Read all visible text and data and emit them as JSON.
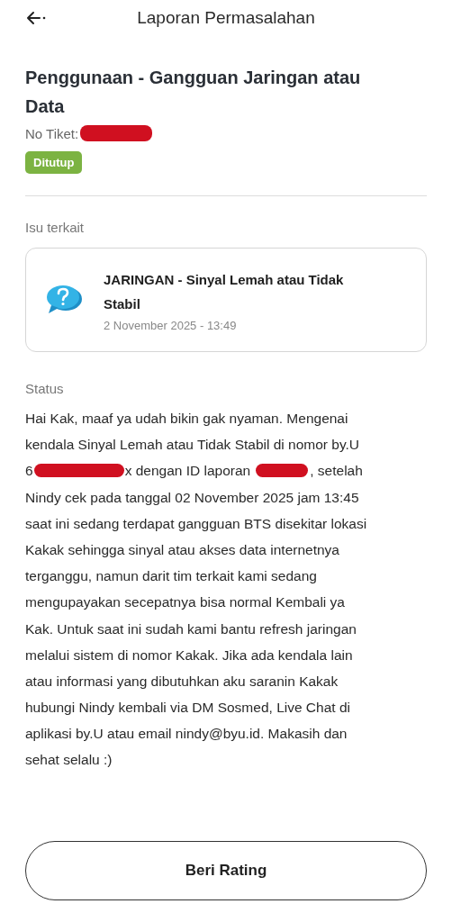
{
  "header": {
    "title": "Laporan Permasalahan"
  },
  "ticket": {
    "title": "Penggunaan - Gangguan Jaringan atau Data",
    "number_label": "No Tiket:",
    "number_redacted": true,
    "status": "Ditutup"
  },
  "related": {
    "label": "Isu terkait",
    "title": "JARINGAN - Sinyal Lemah atau Tidak Stabil",
    "time": "2 November 2025 - 13:49"
  },
  "status": {
    "label": "Status",
    "message_lines": [
      [
        {
          "kind": "text",
          "text": "Hai Kak, maaf ya udah bikin gak nyaman. Mengenai"
        }
      ],
      [
        {
          "kind": "text",
          "text": "kendala Sinyal Lemah atau Tidak Stabil di nomor by.U"
        }
      ],
      [
        {
          "kind": "text",
          "text": "6"
        },
        {
          "kind": "redaction"
        },
        {
          "kind": "text",
          "text": "x dengan ID laporan"
        },
        {
          "kind": "redaction"
        },
        {
          "kind": "text",
          "text": ", setelah"
        }
      ],
      [
        {
          "kind": "text",
          "text": "Nindy cek pada tanggal 02 November 2025 jam 13:45"
        }
      ],
      [
        {
          "kind": "text",
          "text": "saat ini sedang terdapat gangguan BTS disekitar lokasi"
        }
      ],
      [
        {
          "kind": "text",
          "text": "Kakak sehingga sinyal atau akses data internetnya"
        }
      ],
      [
        {
          "kind": "text",
          "text": "terganggu, namun darit tim terkait kami sedang"
        }
      ],
      [
        {
          "kind": "text",
          "text": "mengupayakan secepatnya bisa normal Kembali ya"
        }
      ],
      [
        {
          "kind": "text",
          "text": "Kak. Untuk saat ini sudah kami bantu refresh jaringan"
        }
      ],
      [
        {
          "kind": "text",
          "text": "melalui sistem di nomor Kakak. Jika ada kendala lain"
        }
      ],
      [
        {
          "kind": "text",
          "text": "atau informasi yang dibutuhkan aku saranin Kakak"
        }
      ],
      [
        {
          "kind": "text",
          "text": "hubungi Nindy kembali via DM Sosmed, Live Chat di"
        }
      ],
      [
        {
          "kind": "text",
          "text": "aplikasi by.U atau email nindy@byu.id. Makasih dan"
        }
      ],
      [
        {
          "kind": "text",
          "text": "sehat selalu :)"
        }
      ]
    ]
  },
  "button": "Beri Rating"
}
